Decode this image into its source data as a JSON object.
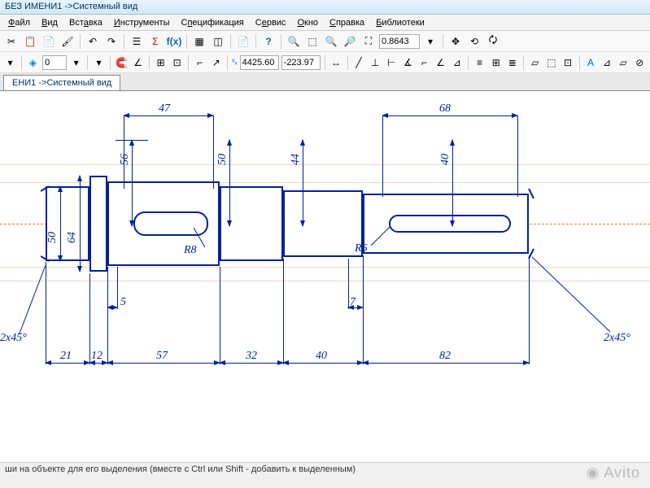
{
  "title": "БЕЗ ИМЕНИ1 ->Системный вид",
  "menu": {
    "file": "Файл",
    "view": "Вид",
    "insert": "Вставка",
    "tools": "Инструменты",
    "spec": "Спецификация",
    "service": "Сервис",
    "window": "Окно",
    "help": "Справка",
    "libs": "Библиотеки"
  },
  "toolbar1": {
    "zoom": "0.8643",
    "x": "4425.60",
    "y": "-223.97"
  },
  "toolbar2": {
    "scale": "0"
  },
  "tab": "ЕНИ1 ->Системный вид",
  "dims": {
    "top47": "47",
    "top68": "68",
    "d56": "56",
    "d50a": "50",
    "d44": "44",
    "d40": "40",
    "d50b": "50",
    "d64": "64",
    "r8": "R8",
    "r6": "R6",
    "ch_left": "2x45°",
    "ch_right": "2x45°",
    "l21": "21",
    "l12": "12",
    "l5": "5",
    "l57": "57",
    "l32": "32",
    "l7": "7",
    "l40": "40",
    "l82": "82"
  },
  "status": "ши на объекте для его выделения (вместе с Ctrl или Shift - добавить к выделенным)",
  "watermark": "Avito"
}
